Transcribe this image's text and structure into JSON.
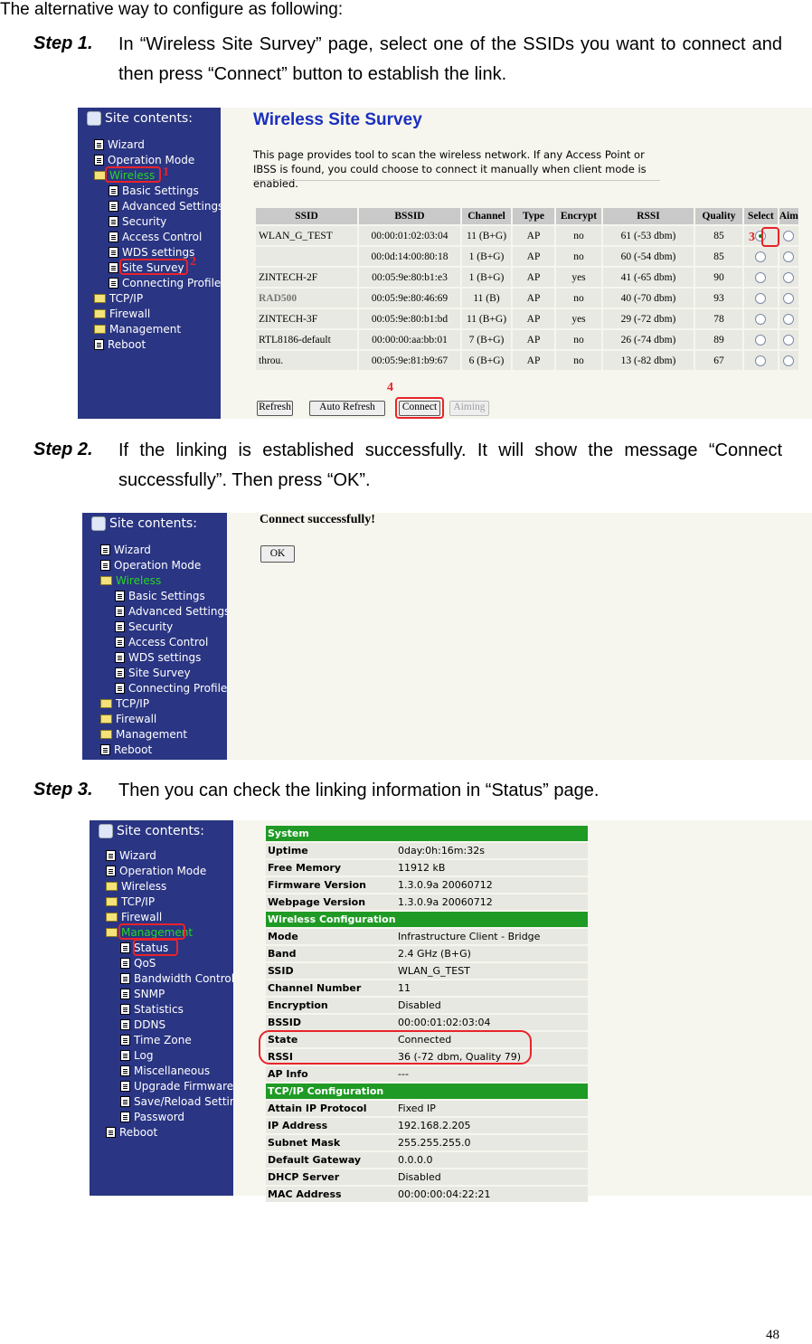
{
  "intro": "The alternative way to configure as following:",
  "steps": [
    {
      "label": "Step 1.",
      "text": "In “Wireless Site Survey” page, select one of the SSIDs you want to connect and then press “Connect” button to establish the link."
    },
    {
      "label": "Step 2.",
      "text": "If the linking is established successfully. It will show the message “Connect successfully”. Then press “OK”."
    },
    {
      "label": "Step 3.",
      "text": "Then you can check the linking information in “Status” page."
    }
  ],
  "sidebar_title": "Site contents:",
  "menu1": [
    "Wizard",
    "Operation Mode",
    "Wireless",
    "Basic Settings",
    "Advanced Settings",
    "Security",
    "Access Control",
    "WDS settings",
    "Site Survey",
    "Connecting Profile",
    "TCP/IP",
    "Firewall",
    "Management",
    "Reboot"
  ],
  "menu3": [
    "Wizard",
    "Operation Mode",
    "Wireless",
    "TCP/IP",
    "Firewall",
    "Management",
    "Status",
    "QoS",
    "Bandwidth Control",
    "SNMP",
    "Statistics",
    "DDNS",
    "Time Zone",
    "Log",
    "Miscellaneous",
    "Upgrade Firmware",
    "Save/Reload Setting",
    "Password",
    "Reboot"
  ],
  "survey": {
    "title": "Wireless Site Survey",
    "description": "This page provides tool to scan the wireless network. If any Access Point or IBSS is found, you could choose to connect it manually when client mode is enabled.",
    "columns": [
      "SSID",
      "BSSID",
      "Channel",
      "Type",
      "Encrypt",
      "RSSI",
      "Quality",
      "Select",
      "Aim"
    ],
    "rows": [
      [
        "WLAN_G_TEST",
        "00:00:01:02:03:04",
        "11 (B+G)",
        "AP",
        "no",
        "61 (-53 dbm)",
        "85"
      ],
      [
        "",
        "00:0d:14:00:80:18",
        "1 (B+G)",
        "AP",
        "no",
        "60 (-54 dbm)",
        "85"
      ],
      [
        "ZINTECH-2F",
        "00:05:9e:80:b1:e3",
        "1 (B+G)",
        "AP",
        "yes",
        "41 (-65 dbm)",
        "90"
      ],
      [
        "RAD500",
        "00:05:9e:80:46:69",
        "11 (B)",
        "AP",
        "no",
        "40 (-70 dbm)",
        "93"
      ],
      [
        "ZINTECH-3F",
        "00:05:9e:80:b1:bd",
        "11 (B+G)",
        "AP",
        "yes",
        "29 (-72 dbm)",
        "78"
      ],
      [
        "RTL8186-default",
        "00:00:00:aa:bb:01",
        "7 (B+G)",
        "AP",
        "no",
        "26 (-74 dbm)",
        "89"
      ],
      [
        "throu.",
        "00:05:9e:81:b9:67",
        "6 (B+G)",
        "AP",
        "no",
        "13 (-82 dbm)",
        "67"
      ]
    ],
    "buttons": {
      "refresh": "Refresh",
      "auto_refresh": "Auto Refresh",
      "connect": "Connect",
      "aiming": "Aiming"
    }
  },
  "callouts": [
    "1",
    "2",
    "3",
    "4"
  ],
  "connect_msg": "Connect successfully!",
  "ok_label": "OK",
  "status": {
    "sections": [
      {
        "title": "System",
        "rows": [
          [
            "Uptime",
            "0day:0h:16m:32s"
          ],
          [
            "Free Memory",
            "11912 kB"
          ],
          [
            "Firmware Version",
            "1.3.0.9a 20060712"
          ],
          [
            "Webpage Version",
            "1.3.0.9a 20060712"
          ]
        ]
      },
      {
        "title": "Wireless Configuration",
        "rows": [
          [
            "Mode",
            "Infrastructure Client - Bridge"
          ],
          [
            "Band",
            "2.4 GHz (B+G)"
          ],
          [
            "SSID",
            "WLAN_G_TEST"
          ],
          [
            "Channel Number",
            "11"
          ],
          [
            "Encryption",
            "Disabled"
          ],
          [
            "BSSID",
            "00:00:01:02:03:04"
          ],
          [
            "State",
            "Connected"
          ],
          [
            "RSSI",
            "36 (-72 dbm, Quality 79)"
          ],
          [
            "AP Info",
            "---"
          ]
        ]
      },
      {
        "title": "TCP/IP Configuration",
        "rows": [
          [
            "Attain IP Protocol",
            "Fixed IP"
          ],
          [
            "IP Address",
            "192.168.2.205"
          ],
          [
            "Subnet Mask",
            "255.255.255.0"
          ],
          [
            "Default Gateway",
            "0.0.0.0"
          ],
          [
            "DHCP Server",
            "Disabled"
          ],
          [
            "MAC Address",
            "00:00:00:04:22:21"
          ]
        ]
      }
    ]
  },
  "page_number": "48",
  "colors": {
    "sidebar_bg": "#2a3583",
    "highlight": "#e8232b",
    "active_menu": "#27d527",
    "section_green": "#1f9a24",
    "title_blue": "#1b2fbd"
  }
}
